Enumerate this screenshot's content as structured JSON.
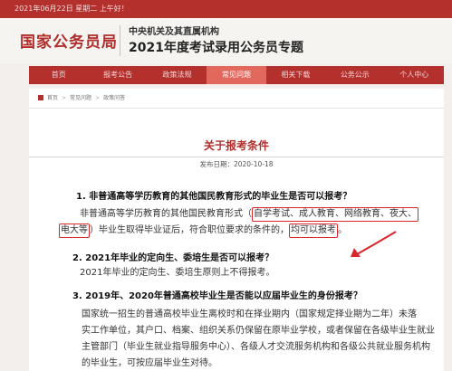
{
  "topbar": {
    "date_text": "2021年06月22日  星期二  上午好！"
  },
  "header": {
    "logo_text": "国家公务员局",
    "org_text": "中央机关及其直属机构",
    "topic_text": "2021年度考试录用公务员专题"
  },
  "nav": {
    "items": [
      "首页",
      "报考公告",
      "政策法规",
      "常见问题",
      "相关下载",
      "公务公示",
      "个人中心"
    ],
    "active_index": 3
  },
  "breadcrumb": {
    "items": [
      "首页",
      "常见问题",
      "政策问答"
    ]
  },
  "article": {
    "title": "关于报考条件",
    "publish_line": "发布日期：2020-10-18",
    "q1": "1. 非普通高等学历教育的其他国民教育形式的毕业生是否可以报考？",
    "a1_prefix": "非普通高等学历教育的其他国民教育形式（",
    "a1_hl1": "自学考试、成人教育、网络教育、夜大、",
    "a1_hl2": "电大等",
    "a1_mid": "）毕业生取得毕业证后，符合职位要求的条件的，",
    "a1_hl3": "均可以报考",
    "a1_end": "。",
    "q2": "2. 2021年毕业的定向生、委培生是否可以报考？",
    "a2": "2021年毕业的定向生、委培生原则上不得报考。",
    "q3": "3. 2019年、2020年普通高校毕业生是否能以应届毕业生的身份报考？",
    "a3_l1": "国家统一招生的普通高校毕业生离校时和在择业期内（国家规定择业期为二年）未落",
    "a3_l2": "实工作单位，其户口、档案、组织关系仍保留在原毕业学校，或者保留在各级毕业生就业",
    "a3_l3": "主管部门（毕业生就业指导服务中心）、各级人才交流服务机构和各级公共就业服务机构",
    "a3_l4": "的毕业生，可按应届毕业生对待。"
  },
  "colors": {
    "brand_red": "#b3302d",
    "active_tab": "#e2675c",
    "highlight": "#d9262a"
  }
}
